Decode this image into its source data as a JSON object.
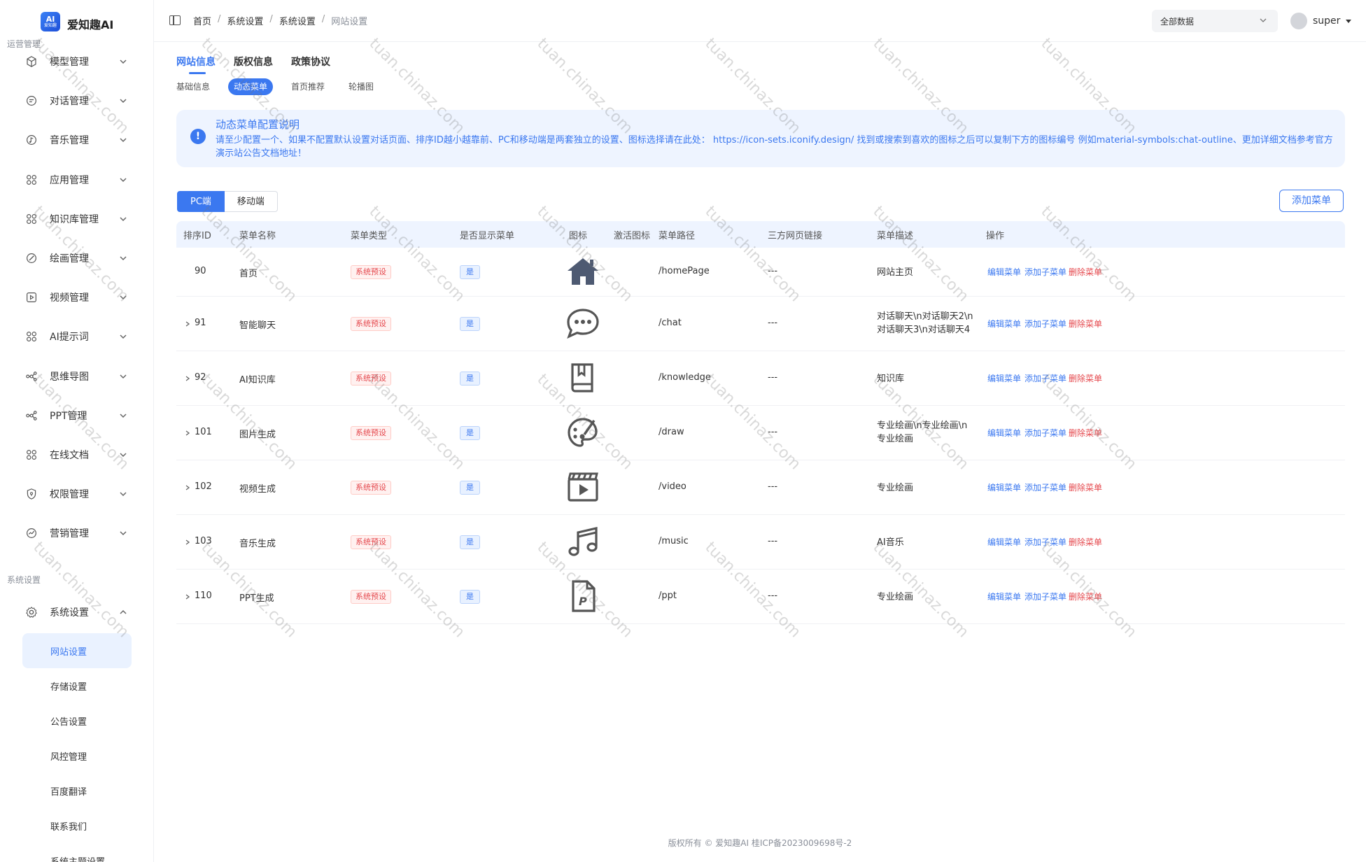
{
  "brand": {
    "logo_line1": "AI",
    "logo_line2": "爱知趣",
    "name": "爱知趣AI"
  },
  "sidebar": {
    "group_ops": "运营管理",
    "group_sys": "系统设置",
    "items": [
      {
        "label": "模型管理",
        "icon": "cube-icon"
      },
      {
        "label": "对话管理",
        "icon": "chat-icon"
      },
      {
        "label": "音乐管理",
        "icon": "music-icon"
      },
      {
        "label": "应用管理",
        "icon": "grid-icon"
      },
      {
        "label": "知识库管理",
        "icon": "grid-icon"
      },
      {
        "label": "绘画管理",
        "icon": "brush-icon"
      },
      {
        "label": "视频管理",
        "icon": "video-icon"
      },
      {
        "label": "AI提示词",
        "icon": "grid-icon"
      },
      {
        "label": "思维导图",
        "icon": "mindmap-icon"
      },
      {
        "label": "PPT管理",
        "icon": "mindmap-icon"
      },
      {
        "label": "在线文档",
        "icon": "grid-icon"
      },
      {
        "label": "权限管理",
        "icon": "shield-icon"
      },
      {
        "label": "营销管理",
        "icon": "chart-icon"
      }
    ],
    "sys_item": {
      "label": "系统设置",
      "icon": "gear-icon"
    },
    "sub_items": [
      {
        "label": "网站设置",
        "active": true
      },
      {
        "label": "存储设置"
      },
      {
        "label": "公告设置"
      },
      {
        "label": "风控管理"
      },
      {
        "label": "百度翻译"
      },
      {
        "label": "联系我们"
      },
      {
        "label": "系统主题设置"
      }
    ]
  },
  "header": {
    "breadcrumb": [
      "首页",
      "系统设置",
      "系统设置",
      "网站设置"
    ],
    "data_select": "全部数据",
    "user": "super"
  },
  "tabs": [
    "网站信息",
    "版权信息",
    "政策协议"
  ],
  "subtabs": [
    "基础信息",
    "动态菜单",
    "首页推荐",
    "轮播图"
  ],
  "alert": {
    "title": "动态菜单配置说明",
    "body": "请至少配置一个、如果不配置默认设置对话页面、排序ID越小越靠前、PC和移动端是两套独立的设置、图标选择请在此处： https://icon-sets.iconify.design/ 找到或搜索到喜欢的图标之后可以复制下方的图标编号 例如material-symbols:chat-outline、更加详细文档参考官方演示站公告文档地址！"
  },
  "segment": [
    "PC端",
    "移动端"
  ],
  "add_menu_button": "添加菜单",
  "table": {
    "columns": [
      "排序ID",
      "菜单名称",
      "菜单类型",
      "是否显示菜单",
      "图标",
      "激活图标",
      "菜单路径",
      "三方网页链接",
      "菜单描述",
      "操作"
    ],
    "actions": [
      "编辑菜单",
      "添加子菜单",
      "删除菜单"
    ],
    "rows": [
      {
        "id": "90",
        "name": "首页",
        "type": "系统预设",
        "visible": "是",
        "icon": "home-icon",
        "path": "/homePage",
        "link": "---",
        "desc": "网站主页",
        "expandable": false
      },
      {
        "id": "91",
        "name": "智能聊天",
        "type": "系统预设",
        "visible": "是",
        "icon": "chat-bubble-icon",
        "path": "/chat",
        "link": "---",
        "desc": "对话聊天\\n对话聊天2\\n对话聊天3\\n对话聊天4",
        "expandable": true
      },
      {
        "id": "92",
        "name": "AI知识库",
        "type": "系统预设",
        "visible": "是",
        "icon": "book-icon",
        "path": "/knowledge",
        "link": "---",
        "desc": "知识库",
        "expandable": true
      },
      {
        "id": "101",
        "name": "图片生成",
        "type": "系统预设",
        "visible": "是",
        "icon": "palette-icon",
        "path": "/draw",
        "link": "---",
        "desc": "专业绘画\\n专业绘画\\n专业绘画",
        "expandable": true
      },
      {
        "id": "102",
        "name": "视频生成",
        "type": "系统预设",
        "visible": "是",
        "icon": "clapper-icon",
        "path": "/video",
        "link": "---",
        "desc": "专业绘画",
        "expandable": true
      },
      {
        "id": "103",
        "name": "音乐生成",
        "type": "系统预设",
        "visible": "是",
        "icon": "music-note-icon",
        "path": "/music",
        "link": "---",
        "desc": "AI音乐",
        "expandable": true
      },
      {
        "id": "110",
        "name": "PPT生成",
        "type": "系统预设",
        "visible": "是",
        "icon": "ppt-file-icon",
        "path": "/ppt",
        "link": "---",
        "desc": "专业绘画",
        "expandable": true
      }
    ]
  },
  "footer": "版权所有 © 爱知趣AI   桂ICP备2023009698号-2",
  "watermark": "tuan.chinaz.com",
  "colors": {
    "accent": "#3b78f0",
    "danger": "#e5484d",
    "alert_bg": "#eef4ff"
  }
}
